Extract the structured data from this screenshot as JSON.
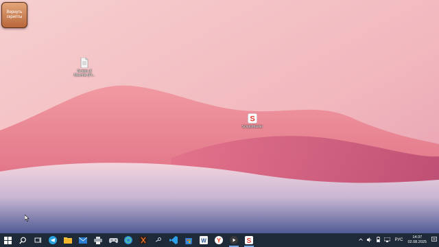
{
  "overlay_button": {
    "label": "Вернуть скрипты"
  },
  "desktop_icons": [
    {
      "label": "Scripts of\nMaxmas (Pl..."
    },
    {
      "label": "ScriptsMaster"
    }
  ],
  "taskbar": {
    "apps": [
      "start-icon",
      "search-icon",
      "task-view-icon",
      "telegram-icon",
      "explorer-icon",
      "mail-icon",
      "printer-icon",
      "gamepad-icon",
      "edge-icon",
      "steam-icon",
      "vscode-icon",
      "store-icon",
      "word-icon",
      "yandex-icon",
      "obs-icon",
      "scriptsmaster-icon"
    ]
  },
  "tray": {
    "lang": "РУС",
    "time": "14:37",
    "date": "02.08.2025"
  }
}
